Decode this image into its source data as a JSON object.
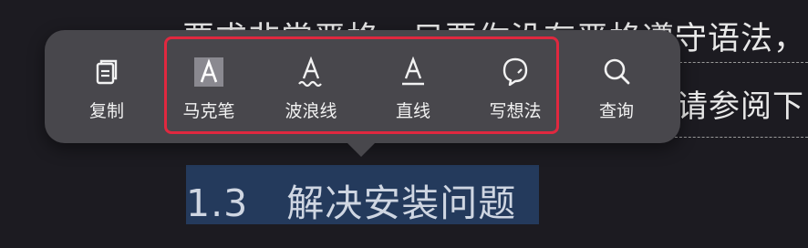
{
  "background": {
    "line1": "要求非常严格，只要你没有严格遵守语法，",
    "line2": "请参阅下"
  },
  "selection": {
    "text": "1.3　解决安装问题"
  },
  "toolbar": {
    "items": [
      {
        "label": "复制",
        "icon": "copy-icon"
      },
      {
        "label": "马克笔",
        "icon": "marker-icon"
      },
      {
        "label": "波浪线",
        "icon": "wavy-underline-icon"
      },
      {
        "label": "直线",
        "icon": "straight-underline-icon"
      },
      {
        "label": "写想法",
        "icon": "thought-bubble-icon"
      },
      {
        "label": "查询",
        "icon": "search-icon"
      }
    ]
  },
  "colors": {
    "highlight_border": "#e0283f",
    "selection_bg": "#243a5c",
    "toolbar_bg": "#48474c"
  }
}
